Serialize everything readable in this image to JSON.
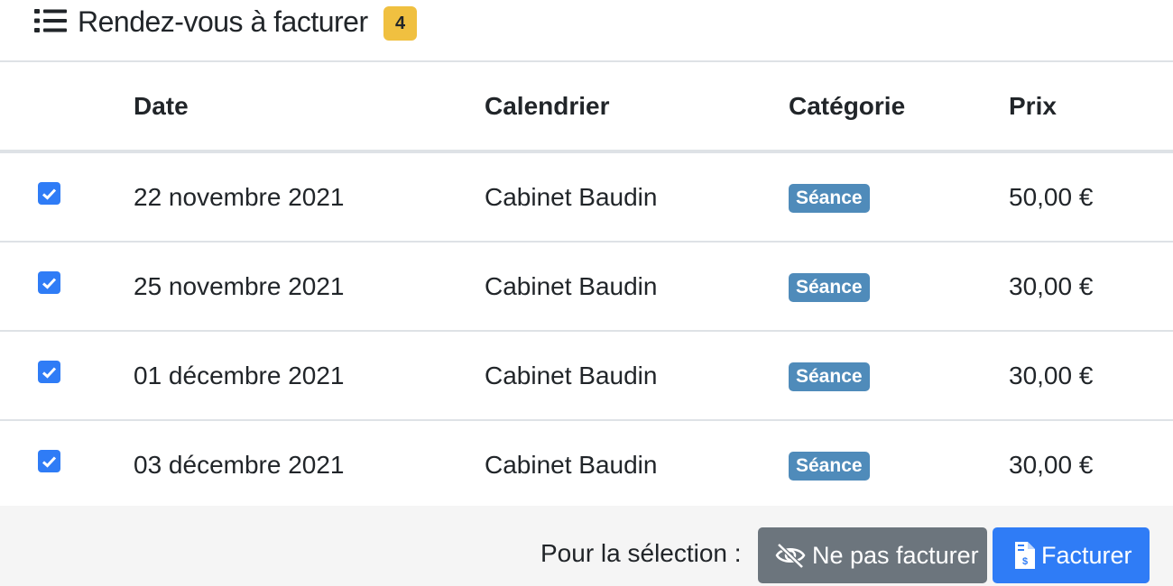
{
  "header": {
    "icon": "list-icon",
    "title": "Rendez-vous à facturer",
    "count": "4",
    "count_color": "#f0c040"
  },
  "table": {
    "columns": [
      "",
      "Date",
      "Calendrier",
      "Catégorie",
      "Prix"
    ],
    "rows": [
      {
        "checked": true,
        "date": "22 novembre 2021",
        "calendar": "Cabinet Baudin",
        "category": "Séance",
        "price": "50,00 €"
      },
      {
        "checked": true,
        "date": "25 novembre 2021",
        "calendar": "Cabinet Baudin",
        "category": "Séance",
        "price": "30,00 €"
      },
      {
        "checked": true,
        "date": "01 décembre 2021",
        "calendar": "Cabinet Baudin",
        "category": "Séance",
        "price": "30,00 €"
      },
      {
        "checked": true,
        "date": "03 décembre 2021",
        "calendar": "Cabinet Baudin",
        "category": "Séance",
        "price": "30,00 €"
      }
    ]
  },
  "footer": {
    "selection_label": "Pour la sélection :",
    "ignore_button": {
      "label": "Ne pas facturer",
      "icon": "eye-slash-icon",
      "color": "#6c757d"
    },
    "invoice_button": {
      "label": "Facturer",
      "icon": "invoice-dollar-icon",
      "color": "#2f7cf6"
    }
  }
}
